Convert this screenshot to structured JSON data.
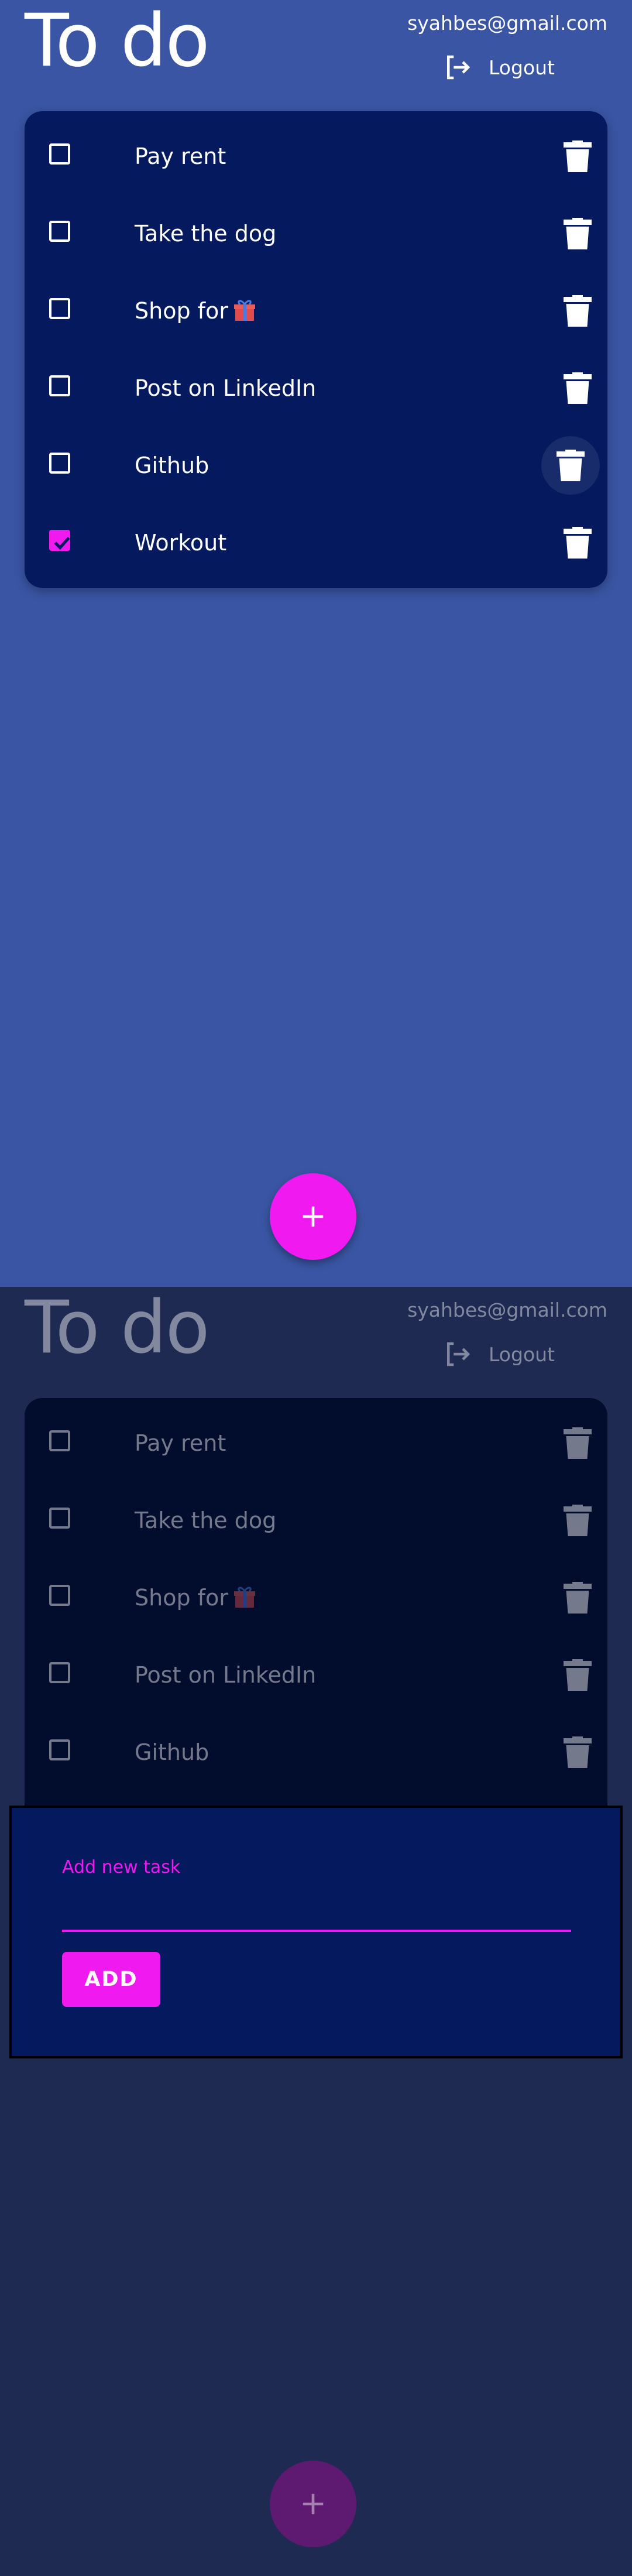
{
  "app": {
    "title": "To do",
    "user_email": "syahbes@gmail.com",
    "logout_label": "Logout"
  },
  "tasks": [
    {
      "label": "Pay rent",
      "done": false
    },
    {
      "label": "Take the dog",
      "done": false
    },
    {
      "label": "Shop for",
      "done": false,
      "emoji": "gift-icon"
    },
    {
      "label": "Post on LinkedIn",
      "done": false
    },
    {
      "label": "Github",
      "done": false
    },
    {
      "label": "Workout",
      "done": true
    }
  ],
  "dialog": {
    "field_label": "Add new task",
    "field_value": "",
    "add_label": "ADD"
  },
  "colors": {
    "primary_bg": "#3a55a4",
    "card_bg": "#051a5e",
    "accent": "#f019f0",
    "text": "#ffffff"
  },
  "fab": {
    "icon": "plus-icon"
  }
}
